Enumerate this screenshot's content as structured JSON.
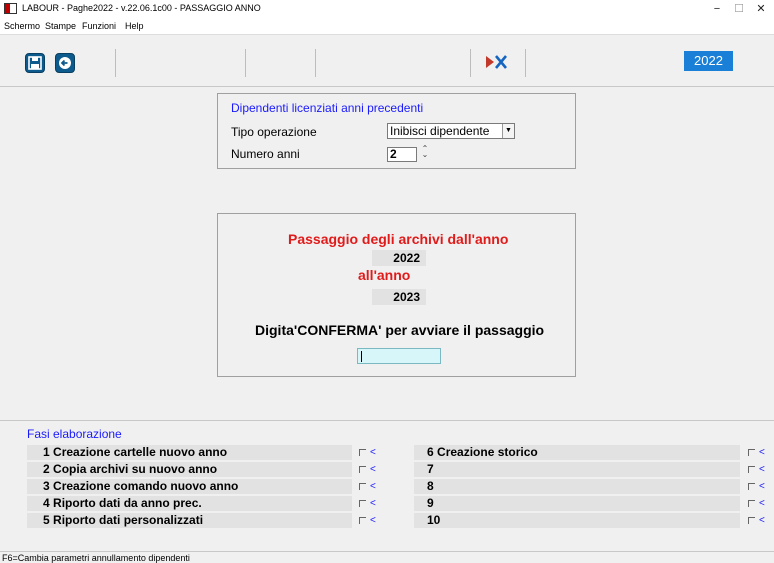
{
  "window": {
    "title": "LABOUR - Paghe2022 - v.22.06.1c00 - PASSAGGIO ANNO",
    "minimize": "−",
    "maximize": "☐",
    "close": "✕"
  },
  "menu": [
    "Schermo",
    "Stampe",
    "Funzioni",
    "Help"
  ],
  "toolbar": {
    "year": "2022"
  },
  "licenziati": {
    "heading": "Dipendenti licenziati anni precedenti",
    "tipo_label": "Tipo operazione",
    "tipo_value": "Inibisci dipendente",
    "numero_label": "Numero anni",
    "numero_value": "2"
  },
  "passaggio": {
    "title": "Passaggio degli archivi dall'anno",
    "from_year": "2022",
    "to_label": "all'anno",
    "to_year": "2023",
    "confirm_prompt": "Digita'CONFERMA' per avviare il passaggio",
    "confirm_value": ""
  },
  "fasi": {
    "heading": "Fasi elaborazione",
    "left": [
      {
        "num": "1",
        "label": "Creazione cartelle nuovo anno"
      },
      {
        "num": "2",
        "label": "Copia archivi su nuovo anno"
      },
      {
        "num": "3",
        "label": "Creazione comando nuovo anno"
      },
      {
        "num": "4",
        "label": "Riporto dati da anno prec."
      },
      {
        "num": "5",
        "label": "Riporto dati personalizzati"
      }
    ],
    "right": [
      {
        "num": "6",
        "label": "Creazione storico"
      },
      {
        "num": "7",
        "label": ""
      },
      {
        "num": "8",
        "label": ""
      },
      {
        "num": "9",
        "label": ""
      },
      {
        "num": "10",
        "label": ""
      }
    ],
    "marker": "<"
  },
  "status": {
    "text": "F6=Cambia parametri annullamento dipendenti"
  },
  "colors": {
    "accent_blue": "#1a7fd6",
    "title_red": "#e11a1a",
    "label_blue": "#1a1aff",
    "input_cyan": "#d7f6fa"
  }
}
